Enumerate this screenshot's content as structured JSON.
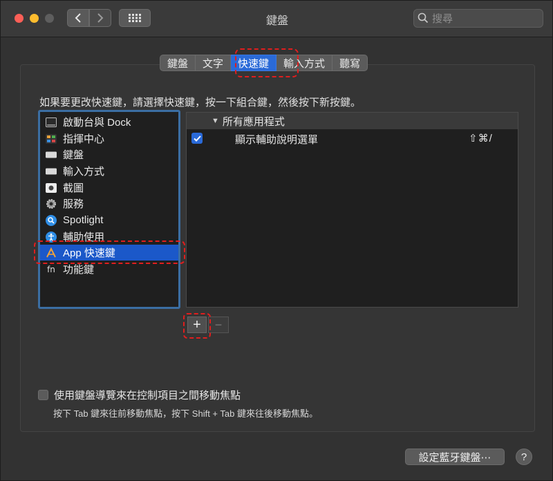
{
  "window": {
    "title": "鍵盤"
  },
  "toolbar": {
    "search_placeholder": "搜尋"
  },
  "tabs": [
    {
      "label": "鍵盤",
      "active": false
    },
    {
      "label": "文字",
      "active": false
    },
    {
      "label": "快速鍵",
      "active": true
    },
    {
      "label": "輸入方式",
      "active": false
    },
    {
      "label": "聽寫",
      "active": false
    }
  ],
  "instruction": "如果要更改快速鍵，請選擇快速鍵，按一下組合鍵，然後按下新按鍵。",
  "categories": [
    {
      "label": "啟動台與 Dock",
      "icon": "launchpad-dock-icon"
    },
    {
      "label": "指揮中心",
      "icon": "mission-control-icon"
    },
    {
      "label": "鍵盤",
      "icon": "keyboard-icon"
    },
    {
      "label": "輸入方式",
      "icon": "input-sources-icon"
    },
    {
      "label": "截圖",
      "icon": "screenshot-icon"
    },
    {
      "label": "服務",
      "icon": "gear-icon"
    },
    {
      "label": "Spotlight",
      "icon": "spotlight-icon"
    },
    {
      "label": "輔助使用",
      "icon": "accessibility-icon"
    },
    {
      "label": "App 快速鍵",
      "icon": "app-store-icon",
      "selected": true
    },
    {
      "label": "功能鍵",
      "icon": "fn-icon"
    }
  ],
  "shortcuts": {
    "group_label": "所有應用程式",
    "items": [
      {
        "label": "顯示輔助說明選單",
        "keys": "⇧⌘/",
        "checked": true
      }
    ]
  },
  "buttons": {
    "add": "+",
    "remove": "−",
    "bluetooth": "設定藍牙鍵盤⋯",
    "help": "?"
  },
  "keyboard_nav": {
    "label": "使用鍵盤導覽來在控制項目之間移動焦點",
    "hint": "按下 Tab 鍵來往前移動焦點，按下 Shift + Tab 鍵來往後移動焦點。",
    "checked": false
  },
  "colors": {
    "accent": "#2a6ad8",
    "selection": "#1b58c9",
    "annotation": "#e01e1e"
  }
}
